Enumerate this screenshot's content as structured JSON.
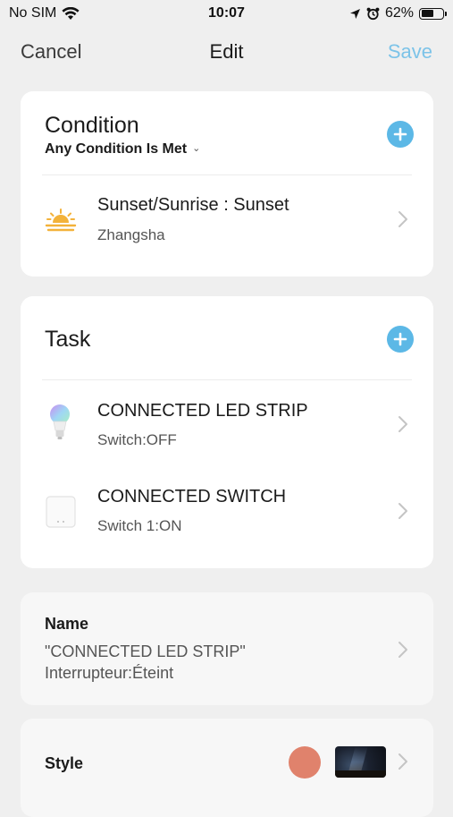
{
  "status_bar": {
    "carrier": "No SIM",
    "time": "10:07",
    "battery_percent": "62%",
    "battery_level": 0.62
  },
  "nav": {
    "cancel": "Cancel",
    "title": "Edit",
    "save": "Save",
    "save_color": "#7cc3e8"
  },
  "condition": {
    "title": "Condition",
    "mode": "Any Condition Is Met",
    "items": [
      {
        "title": "Sunset/Sunrise : Sunset",
        "subtitle": "Zhangsha",
        "icon": "sunset-icon"
      }
    ]
  },
  "task": {
    "title": "Task",
    "items": [
      {
        "title": "CONNECTED LED STRIP",
        "subtitle": "Switch:OFF",
        "icon": "bulb-icon"
      },
      {
        "title": "CONNECTED SWITCH",
        "subtitle": "Switch 1:ON",
        "icon": "switch-device-icon"
      }
    ]
  },
  "name": {
    "label": "Name",
    "value_line1": " \"CONNECTED LED STRIP\"",
    "value_line2": "Interrupteur:Éteint"
  },
  "style": {
    "label": "Style",
    "color": "#e0826c",
    "thumbnail": "night-sky-image"
  },
  "colors": {
    "accent": "#5cb8e6",
    "background": "#efefef"
  }
}
